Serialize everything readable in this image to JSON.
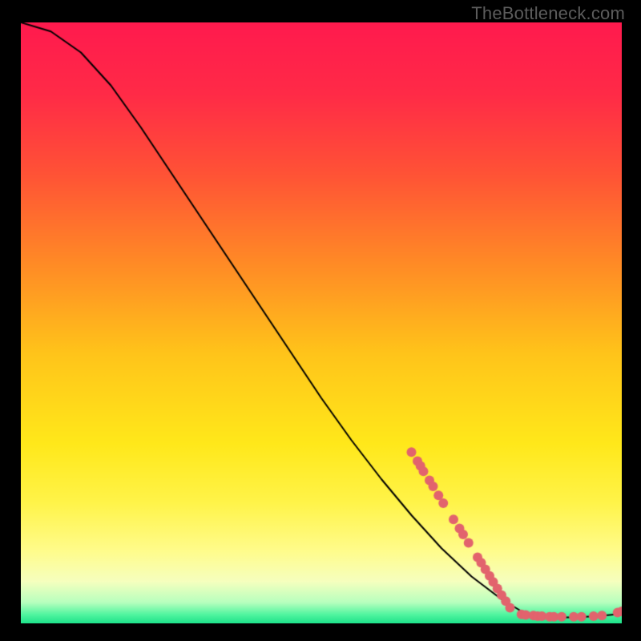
{
  "watermark": "TheBottleneck.com",
  "chart_data": {
    "type": "line",
    "title": "",
    "xlabel": "",
    "ylabel": "",
    "xlim": [
      0,
      100
    ],
    "ylim": [
      0,
      100
    ],
    "grid": false,
    "legend": false,
    "gradient_stops": [
      {
        "t": 0.0,
        "color": "#ff1a4e"
      },
      {
        "t": 0.12,
        "color": "#ff2b47"
      },
      {
        "t": 0.25,
        "color": "#ff5236"
      },
      {
        "t": 0.4,
        "color": "#ff8a26"
      },
      {
        "t": 0.55,
        "color": "#ffc41a"
      },
      {
        "t": 0.7,
        "color": "#ffe81a"
      },
      {
        "t": 0.8,
        "color": "#fff44a"
      },
      {
        "t": 0.88,
        "color": "#fffc8c"
      },
      {
        "t": 0.93,
        "color": "#f6ffbe"
      },
      {
        "t": 0.965,
        "color": "#b8ffbe"
      },
      {
        "t": 0.985,
        "color": "#52f5a0"
      },
      {
        "t": 1.0,
        "color": "#1ee28a"
      }
    ],
    "curve": [
      {
        "x": 0,
        "y": 100
      },
      {
        "x": 5,
        "y": 98.5
      },
      {
        "x": 10,
        "y": 95
      },
      {
        "x": 15,
        "y": 89.5
      },
      {
        "x": 20,
        "y": 82.5
      },
      {
        "x": 25,
        "y": 75
      },
      {
        "x": 30,
        "y": 67.5
      },
      {
        "x": 35,
        "y": 60
      },
      {
        "x": 40,
        "y": 52.5
      },
      {
        "x": 45,
        "y": 45
      },
      {
        "x": 50,
        "y": 37.5
      },
      {
        "x": 55,
        "y": 30.5
      },
      {
        "x": 60,
        "y": 24
      },
      {
        "x": 65,
        "y": 18
      },
      {
        "x": 70,
        "y": 12.5
      },
      {
        "x": 75,
        "y": 7.8
      },
      {
        "x": 80,
        "y": 4
      },
      {
        "x": 84,
        "y": 1.6
      },
      {
        "x": 86,
        "y": 1.1
      },
      {
        "x": 88,
        "y": 1.0
      },
      {
        "x": 92,
        "y": 1.0
      },
      {
        "x": 96,
        "y": 1.2
      },
      {
        "x": 100,
        "y": 1.6
      }
    ],
    "highlight_points": {
      "color": "#e2636d",
      "radius": 6,
      "points": [
        {
          "x": 65,
          "y": 28.5
        },
        {
          "x": 66,
          "y": 27.0
        },
        {
          "x": 66.5,
          "y": 26.2
        },
        {
          "x": 67,
          "y": 25.3
        },
        {
          "x": 68,
          "y": 23.8
        },
        {
          "x": 68.6,
          "y": 22.8
        },
        {
          "x": 69.5,
          "y": 21.3
        },
        {
          "x": 70.3,
          "y": 20.0
        },
        {
          "x": 72,
          "y": 17.3
        },
        {
          "x": 73,
          "y": 15.8
        },
        {
          "x": 73.6,
          "y": 14.8
        },
        {
          "x": 74.5,
          "y": 13.4
        },
        {
          "x": 76,
          "y": 11.0
        },
        {
          "x": 76.6,
          "y": 10.1
        },
        {
          "x": 77.3,
          "y": 9.0
        },
        {
          "x": 78,
          "y": 7.9
        },
        {
          "x": 78.6,
          "y": 6.9
        },
        {
          "x": 79.3,
          "y": 5.8
        },
        {
          "x": 80,
          "y": 4.7
        },
        {
          "x": 80.7,
          "y": 3.7
        },
        {
          "x": 81.4,
          "y": 2.6
        },
        {
          "x": 83.3,
          "y": 1.5
        },
        {
          "x": 84,
          "y": 1.4
        },
        {
          "x": 85.3,
          "y": 1.3
        },
        {
          "x": 86,
          "y": 1.2
        },
        {
          "x": 86.7,
          "y": 1.2
        },
        {
          "x": 88,
          "y": 1.1
        },
        {
          "x": 88.7,
          "y": 1.1
        },
        {
          "x": 90,
          "y": 1.1
        },
        {
          "x": 92,
          "y": 1.1
        },
        {
          "x": 93.3,
          "y": 1.1
        },
        {
          "x": 95.3,
          "y": 1.2
        },
        {
          "x": 96.7,
          "y": 1.3
        },
        {
          "x": 99.3,
          "y": 1.8
        },
        {
          "x": 100,
          "y": 2.0
        }
      ]
    }
  }
}
